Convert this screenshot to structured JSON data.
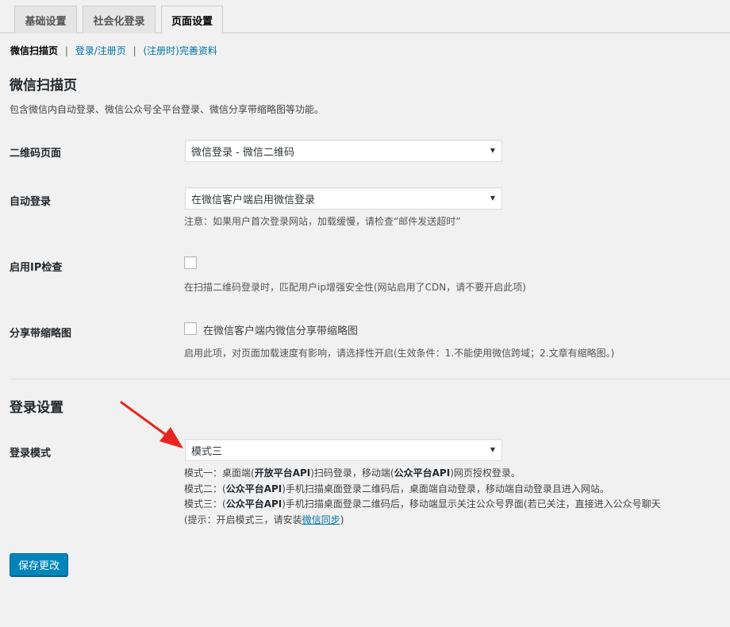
{
  "tabs": [
    "基础设置",
    "社会化登录",
    "页面设置"
  ],
  "subnav": {
    "current": "微信扫描页",
    "separator": "|",
    "links": [
      "登录/注册页",
      "(注册时)完善资料"
    ]
  },
  "wechat_section": {
    "title": "微信扫描页",
    "description": "包含微信内自动登录、微信公众号全平台登录、微信分享带缩略图等功能。",
    "qrcode_page": {
      "label": "二维码页面",
      "value": "微信登录 - 微信二维码"
    },
    "auto_login": {
      "label": "自动登录",
      "value": "在微信客户端启用微信登录",
      "note": "注意：如果用户首次登录网站，加载缓慢，请检查“邮件发送超时”"
    },
    "ip_check": {
      "label": "启用IP检查",
      "checked": false,
      "help": "在扫描二维码登录时，匹配用户ip增强安全性(网站启用了CDN，请不要开启此项)"
    },
    "share_thumb": {
      "label": "分享带缩略图",
      "checked": false,
      "checkbox_label": "在微信客户端内微信分享带缩略图",
      "help": "启用此项，对页面加载速度有影响，请选择性开启(生效条件：1.不能使用微信跨域；2.文章有缩略图。)"
    }
  },
  "login_section": {
    "title": "登录设置",
    "mode": {
      "label": "登录模式",
      "value": "模式三",
      "m1": {
        "p1": "模式一：桌面端(",
        "b1": "开放平台API",
        "p2": ")扫码登录，移动端(",
        "b2": "公众平台API",
        "p3": ")网页授权登录。"
      },
      "m2": {
        "p1": "模式二：(",
        "b1": "公众平台API",
        "p2": ")手机扫描桌面登录二维码后，桌面端自动登录，移动端自动登录且进入网站。"
      },
      "m3": {
        "p1": "模式三：(",
        "b1": "公众平台API",
        "p2": ")手机扫描桌面登录二维码后，移动端显示关注公众号界面(若已关注，直接进入公众号聊天"
      },
      "tip": {
        "p1": "(提示：开启模式三，请安装",
        "link": "微信同步",
        "p2": ")"
      }
    }
  },
  "save_button": "保存更改",
  "colors": {
    "accent": "#0073aa",
    "button": "#0085ba",
    "annotation_arrow": "#e8261f"
  }
}
